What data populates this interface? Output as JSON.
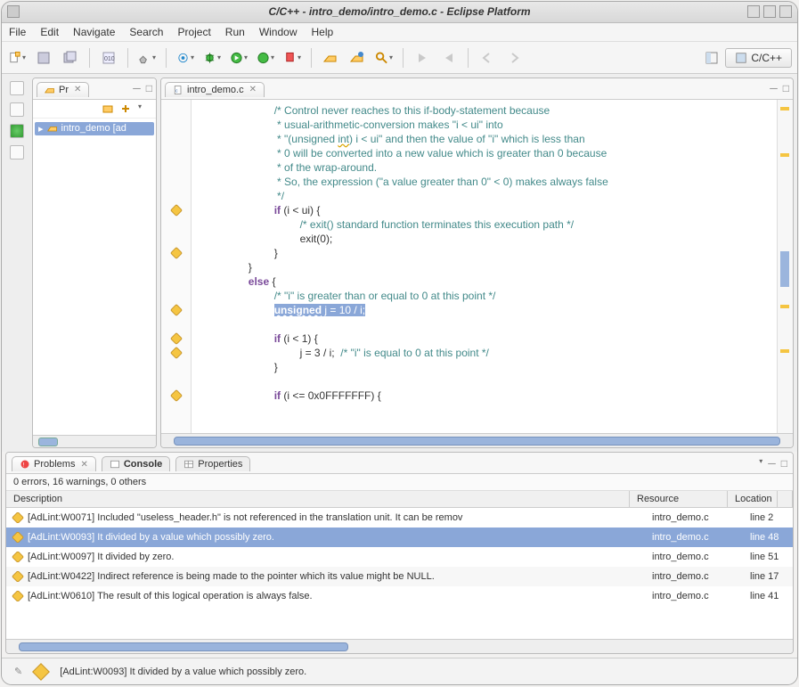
{
  "window": {
    "title": "C/C++ - intro_demo/intro_demo.c - Eclipse Platform"
  },
  "menus": [
    "File",
    "Edit",
    "Navigate",
    "Search",
    "Project",
    "Run",
    "Window",
    "Help"
  ],
  "perspective": {
    "label": "C/C++"
  },
  "proj_panel": {
    "tab_label": "Pr",
    "item": "intro_demo [ad"
  },
  "editor": {
    "tab_label": "intro_demo.c",
    "cmt1": "/* Control never reaches to this if-body-statement because",
    "cmt2": " * usual-arithmetic-conversion makes \"i < ui\" into",
    "cmt3a": " * \"(unsigned ",
    "cmt3b": "int",
    "cmt3c": ") i < ui\" and then the value of \"i\" which is less than",
    "cmt4": " * 0 will be converted into a new value which is greater than 0 because",
    "cmt5": " * of the wrap-around.",
    "cmt6": " * So, the expression (\"a value greater than 0\" < 0) makes always false",
    "cmt7": " */",
    "kw_if": "if",
    "if_head": " (i < ui) {",
    "cmt8": "/* exit() standard function terminates this execution path */",
    "exitln": "exit(0);",
    "close_brace": "}",
    "kw_else": "else",
    "else_head": " {",
    "cmt9": "/* \"i\" is greater than or equal to 0 at this point */",
    "kw_unsigned": "unsigned",
    "hl_rest": " j = 10 / i;",
    "if2_head": " (i < 1) {",
    "j_assign": "j = 3 / i;  ",
    "cmt10": "/* \"i\" is equal to 0 at this point */",
    "if3_head": " (i <= 0x0FFFFFFF) {"
  },
  "problems": {
    "tab_problems": "Problems",
    "tab_console": "Console",
    "tab_properties": "Properties",
    "summary": "0 errors, 16 warnings, 0 others",
    "hdr_desc": "Description",
    "hdr_res": "Resource",
    "hdr_loc": "Location",
    "rows": [
      {
        "desc": "[AdLint:W0071] Included \"useless_header.h\" is not referenced in the translation unit. It can be remov",
        "res": "intro_demo.c",
        "loc": "line 2"
      },
      {
        "desc": "[AdLint:W0093] It divided by a value which possibly zero.",
        "res": "intro_demo.c",
        "loc": "line 48"
      },
      {
        "desc": "[AdLint:W0097] It divided by zero.",
        "res": "intro_demo.c",
        "loc": "line 51"
      },
      {
        "desc": "[AdLint:W0422] Indirect reference is being made to the pointer which its value might be NULL.",
        "res": "intro_demo.c",
        "loc": "line 17"
      },
      {
        "desc": "[AdLint:W0610] The result of this logical operation is always false.",
        "res": "intro_demo.c",
        "loc": "line 41"
      }
    ]
  },
  "status": {
    "msg": "[AdLint:W0093] It divided by a value which possibly zero."
  }
}
